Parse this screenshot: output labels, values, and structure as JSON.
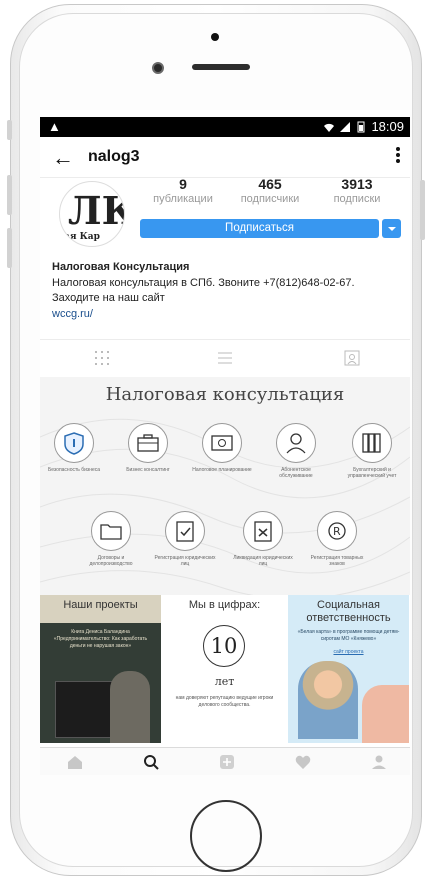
{
  "status": {
    "time": "18:09"
  },
  "header": {
    "username": "nalog3"
  },
  "profile": {
    "stats": [
      {
        "value": "9",
        "label": "публикации"
      },
      {
        "value": "465",
        "label": "подписчики"
      },
      {
        "value": "3913",
        "label": "подписки"
      }
    ],
    "subscribe_label": "Подписаться",
    "avatar_text": "ая Кар"
  },
  "bio": {
    "name": "Налоговая Консультация",
    "line1": "Налоговая консультация в СПб. Звоните +7(812)648-02-67.",
    "line2": "Заходите на наш сайт",
    "link": "wccg.ru/"
  },
  "banner": {
    "title": "Налоговая консультация",
    "services_row1": [
      {
        "icon": "shield-icon",
        "caption": "Безопасность бизнеса"
      },
      {
        "icon": "briefcase-icon",
        "caption": "Бизнес консалтинг"
      },
      {
        "icon": "money-icon",
        "caption": "Налоговое планирование"
      },
      {
        "icon": "person-icon",
        "caption": "Абонентское обслуживание"
      },
      {
        "icon": "binders-icon",
        "caption": "Бухгалтерский и управленческий учет"
      }
    ],
    "services_row2": [
      {
        "icon": "folder-icon",
        "caption": "Договоры и делопроизводство"
      },
      {
        "icon": "clipboard-check-icon",
        "caption": "Регистрация юридических лиц"
      },
      {
        "icon": "clipboard-x-icon",
        "caption": "Ликвидация юридических лиц"
      },
      {
        "icon": "trademark-icon",
        "caption": "Регистрация товарных знаков"
      }
    ]
  },
  "tiles": {
    "projects": {
      "title": "Наши проекты",
      "text": "Книга Дениса Баландина «Предпринимательство: Как заработать деньги не нарушая закон»"
    },
    "numbers": {
      "title": "Мы в цифрах:",
      "value": "10",
      "unit": "лет",
      "text": "нам доверяют репутацию ведущие игроки делового сообщества."
    },
    "social": {
      "title": "Социальная ответственность",
      "text": "«Белая карта» в программе помощи детям-сиротам МО «Княжево»",
      "link": "сайт проекта"
    }
  },
  "colors": {
    "accent": "#3897f0",
    "link": "#1a4e8c"
  }
}
